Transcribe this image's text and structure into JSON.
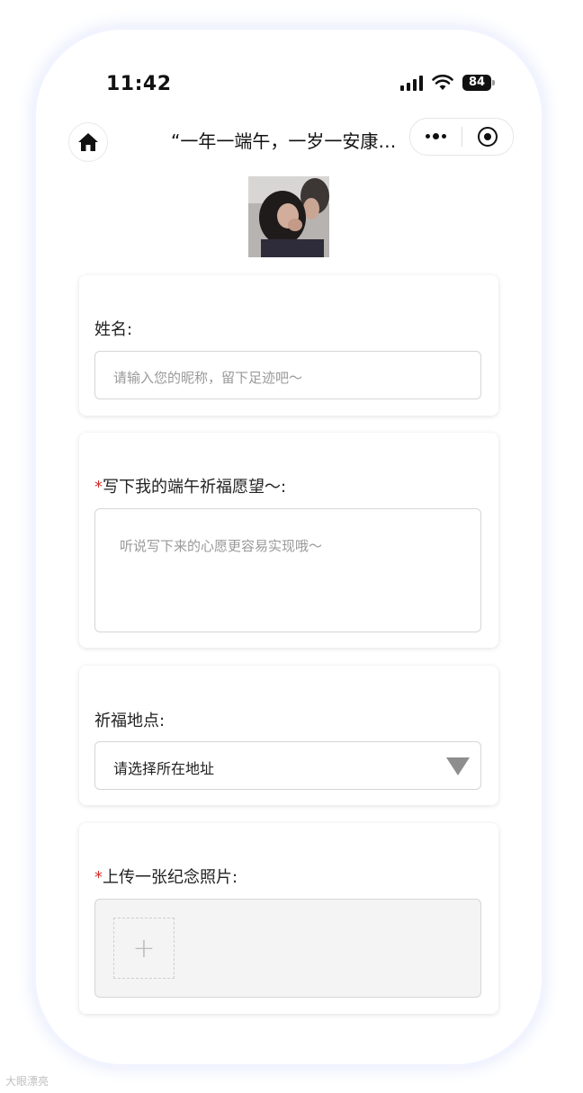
{
  "status": {
    "time": "11:42",
    "battery": "84"
  },
  "nav": {
    "title": "“一年一端午，一岁一安康…"
  },
  "form": {
    "name": {
      "label": "姓名:",
      "placeholder": "请输入您的昵称，留下足迹吧～"
    },
    "wish": {
      "required_mark": "*",
      "label": "写下我的端午祈福愿望～:",
      "placeholder": "听说写下来的心愿更容易实现哦～"
    },
    "location": {
      "label": "祈福地点:",
      "value": "请选择所在地址"
    },
    "photo": {
      "required_mark": "*",
      "label": "上传一张纪念照片:",
      "add_symbol": "+"
    }
  },
  "watermark": "大眼漂亮",
  "colors": {
    "required": "#d32f2f",
    "placeholder": "#999999",
    "border": "#d6d6d6"
  }
}
